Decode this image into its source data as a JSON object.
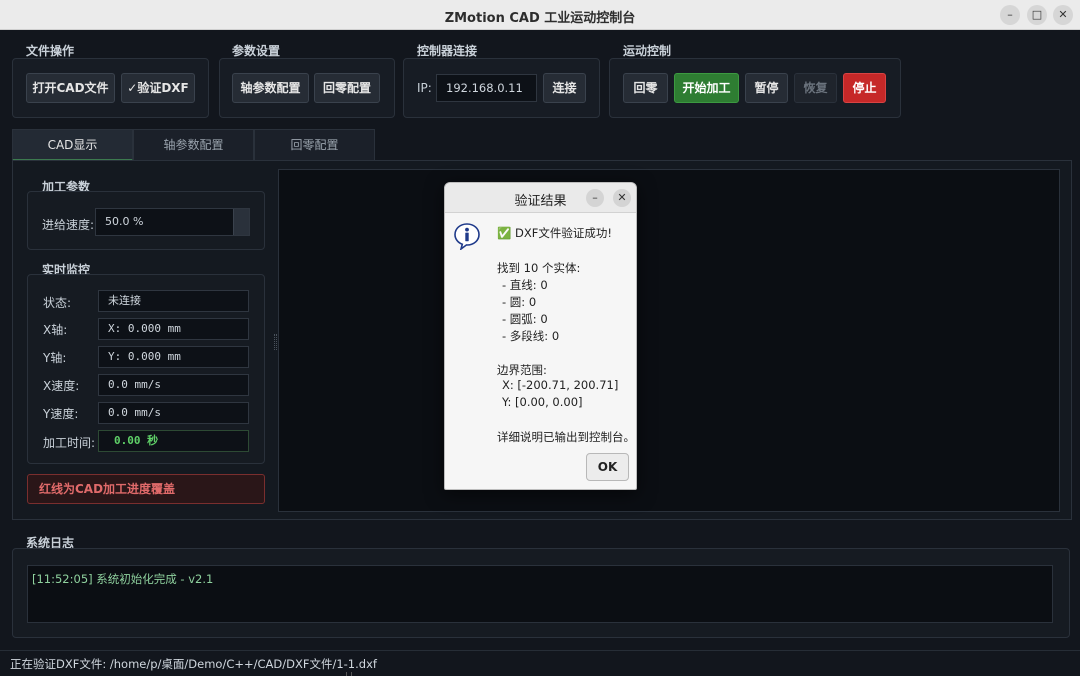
{
  "window": {
    "title": "ZMotion CAD 工业运动控制台",
    "minimize": "–",
    "maximize": "□",
    "close": "✕"
  },
  "toolbar": {
    "file_ops": {
      "title": "文件操作",
      "open_cad": "打开CAD文件",
      "verify_dxf": "✓验证DXF"
    },
    "params": {
      "title": "参数设置",
      "axis_config": "轴参数配置",
      "home_config": "回零配置"
    },
    "controller": {
      "title": "控制器连接",
      "ip_label": "IP:",
      "ip_value": "192.168.0.11",
      "connect": "连接"
    },
    "motion": {
      "title": "运动控制",
      "home": "回零",
      "start": "开始加工",
      "pause": "暂停",
      "resume": "恢复",
      "stop": "停止"
    }
  },
  "tabs": [
    {
      "label": "CAD显示",
      "active": true
    },
    {
      "label": "轴参数配置",
      "active": false
    },
    {
      "label": "回零配置",
      "active": false
    }
  ],
  "machining": {
    "title": "加工参数",
    "feed_label": "进给速度:",
    "feed_value": "50.0 %"
  },
  "monitor": {
    "title": "实时监控",
    "rows": [
      {
        "label": "状态:",
        "value": "未连接"
      },
      {
        "label": "X轴:",
        "value": "X: 0.000 mm"
      },
      {
        "label": "Y轴:",
        "value": "Y: 0.000 mm"
      },
      {
        "label": "X速度:",
        "value": "0.0 mm/s"
      },
      {
        "label": "Y速度:",
        "value": "0.0 mm/s"
      },
      {
        "label": "加工时间:",
        "value": "0.00 秒"
      }
    ]
  },
  "notice": "红线为CAD加工进度覆盖",
  "log": {
    "title": "系统日志",
    "entry": "[11:52:05] 系统初始化完成 - v2.1"
  },
  "status_bar": "正在验证DXF文件: /home/p/桌面/Demo/C++/CAD/DXF文件/1-1.dxf",
  "dialog": {
    "title": "验证结果",
    "minimize": "–",
    "close": "✕",
    "icon": "info-icon",
    "lines": [
      "✅ DXF文件验证成功!",
      "找到 10 个实体:",
      "- 直线: 0",
      "- 圆: 0",
      "- 圆弧: 0",
      "- 多段线: 0",
      "边界范围:",
      "X: [-200.71, 200.71]",
      "Y: [0.00, 0.00]",
      "详细说明已输出到控制台。"
    ],
    "ok": "OK"
  },
  "colors": {
    "accent_green": "#2e7d32",
    "danger_red": "#c62828",
    "log_text": "#8fd19e",
    "time_text": "#5fd068"
  }
}
